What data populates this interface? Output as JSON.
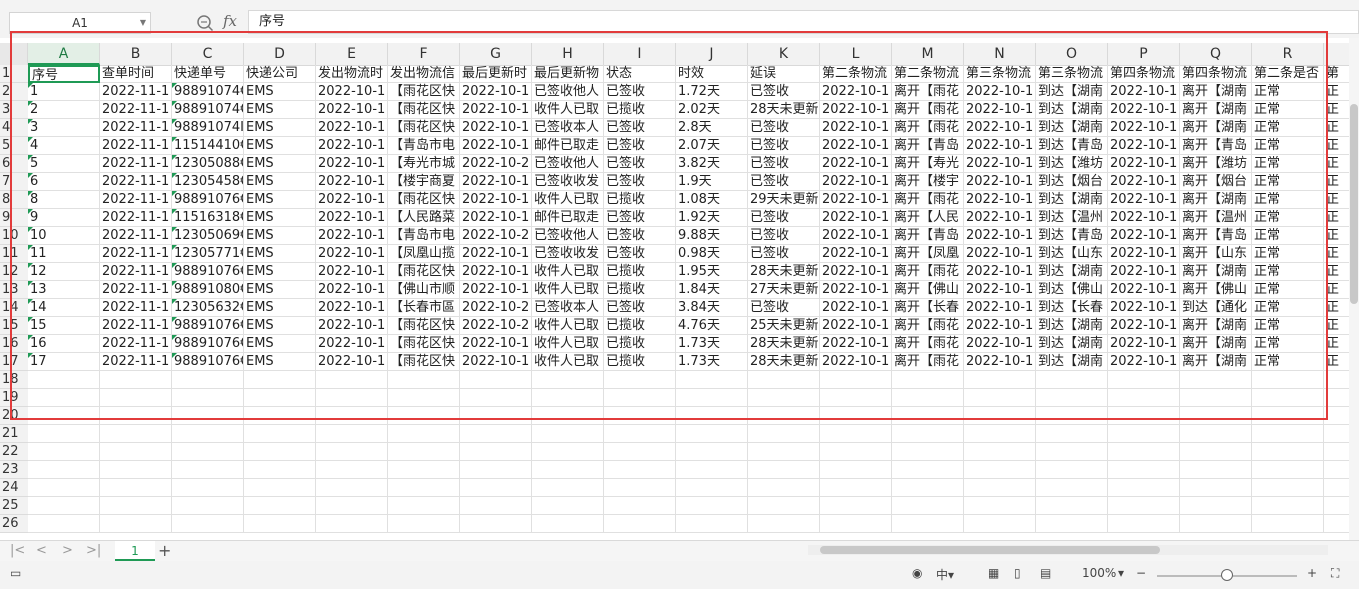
{
  "formula_bar": {
    "name_box": "A1",
    "fx_label": "fx",
    "formula_value": "序号"
  },
  "columns": [
    "A",
    "B",
    "C",
    "D",
    "E",
    "F",
    "G",
    "H",
    "I",
    "J",
    "K",
    "L",
    "M",
    "N",
    "O",
    "P",
    "Q",
    "R"
  ],
  "header_row": [
    "序号",
    "查单时间",
    "快递单号",
    "快递公司",
    "发出物流时",
    "发出物流信",
    "最后更新时",
    "最后更新物",
    "状态",
    "时效",
    "延误",
    "第二条物流",
    "第二条物流",
    "第三条物流",
    "第三条物流",
    "第四条物流",
    "第四条物流",
    "第二条是否",
    "第"
  ],
  "data_rows": [
    [
      "1",
      "2022-11-1",
      "98891074€",
      "EMS",
      "2022-10-1",
      "【雨花区快",
      "2022-10-1",
      "已签收他人",
      "已签收",
      "1.72天",
      "已签收",
      "2022-10-1",
      "离开【雨花",
      "2022-10-1",
      "到达【湖南",
      "2022-10-1",
      "离开【湖南",
      "正常",
      "正"
    ],
    [
      "2",
      "2022-11-1",
      "98891074€",
      "EMS",
      "2022-10-1",
      "【雨花区快",
      "2022-10-1",
      "收件人已取",
      "已揽收",
      "2.02天",
      "28天未更新",
      "2022-10-1",
      "离开【雨花",
      "2022-10-1",
      "到达【湖南",
      "2022-10-1",
      "离开【湖南",
      "正常",
      "正"
    ],
    [
      "3",
      "2022-11-1",
      "98891074I",
      "EMS",
      "2022-10-1",
      "【雨花区快",
      "2022-10-1",
      "已签收本人",
      "已签收",
      "2.8天",
      "已签收",
      "2022-10-1",
      "离开【雨花",
      "2022-10-1",
      "到达【湖南",
      "2022-10-1",
      "离开【湖南",
      "正常",
      "正"
    ],
    [
      "4",
      "2022-11-1",
      "11514410€",
      "EMS",
      "2022-10-1",
      "【青岛市电",
      "2022-10-1",
      "邮件已取走",
      "已签收",
      "2.07天",
      "已签收",
      "2022-10-1",
      "离开【青岛",
      "2022-10-1",
      "到达【青岛",
      "2022-10-1",
      "离开【青岛",
      "正常",
      "正"
    ],
    [
      "5",
      "2022-11-1",
      "12305088€",
      "EMS",
      "2022-10-1",
      "【寿光市城",
      "2022-10-2",
      "已签收他人",
      "已签收",
      "3.82天",
      "已签收",
      "2022-10-1",
      "离开【寿光",
      "2022-10-1",
      "到达【潍坊",
      "2022-10-1",
      "离开【潍坊",
      "正常",
      "正"
    ],
    [
      "6",
      "2022-11-1",
      "12305458€",
      "EMS",
      "2022-10-1",
      "【楼宇商夏",
      "2022-10-1",
      "已签收收发",
      "已签收",
      "1.9天",
      "已签收",
      "2022-10-1",
      "离开【楼宇",
      "2022-10-1",
      "到达【烟台",
      "2022-10-1",
      "离开【烟台",
      "正常",
      "正"
    ],
    [
      "8",
      "2022-11-1",
      "98891076€",
      "EMS",
      "2022-10-1",
      "【雨花区快",
      "2022-10-1",
      "收件人已取",
      "已揽收",
      "1.08天",
      "29天未更新",
      "2022-10-1",
      "离开【雨花",
      "2022-10-1",
      "到达【湖南",
      "2022-10-1",
      "离开【湖南",
      "正常",
      "正"
    ],
    [
      "9",
      "2022-11-1",
      "11516318€",
      "EMS",
      "2022-10-1",
      "【人民路菜",
      "2022-10-1",
      "邮件已取走",
      "已签收",
      "1.92天",
      "已签收",
      "2022-10-1",
      "离开【人民",
      "2022-10-1",
      "到达【温州",
      "2022-10-1",
      "离开【温州",
      "正常",
      "正"
    ],
    [
      "10",
      "2022-11-1",
      "12305069€",
      "EMS",
      "2022-10-1",
      "【青岛市电",
      "2022-10-2",
      "已签收他人",
      "已签收",
      "9.88天",
      "已签收",
      "2022-10-1",
      "离开【青岛",
      "2022-10-1",
      "到达【青岛",
      "2022-10-1",
      "离开【青岛",
      "正常",
      "正"
    ],
    [
      "11",
      "2022-11-1",
      "12305771€",
      "EMS",
      "2022-10-1",
      "【凤凰山揽",
      "2022-10-1",
      "已签收收发",
      "已签收",
      "0.98天",
      "已签收",
      "2022-10-1",
      "离开【凤凰",
      "2022-10-1",
      "到达【山东",
      "2022-10-1",
      "离开【山东",
      "正常",
      "正"
    ],
    [
      "12",
      "2022-11-1",
      "98891076€",
      "EMS",
      "2022-10-1",
      "【雨花区快",
      "2022-10-1",
      "收件人已取",
      "已揽收",
      "1.95天",
      "28天未更新",
      "2022-10-1",
      "离开【雨花",
      "2022-10-1",
      "到达【湖南",
      "2022-10-1",
      "离开【湖南",
      "正常",
      "正"
    ],
    [
      "13",
      "2022-11-1",
      "98891080€",
      "EMS",
      "2022-10-1",
      "【佛山市顺",
      "2022-10-1",
      "收件人已取",
      "已揽收",
      "1.84天",
      "27天未更新",
      "2022-10-1",
      "离开【佛山",
      "2022-10-1",
      "到达【佛山",
      "2022-10-1",
      "离开【佛山",
      "正常",
      "正"
    ],
    [
      "14",
      "2022-11-1",
      "12305632€",
      "EMS",
      "2022-10-1",
      "【长春市區",
      "2022-10-2",
      "已签收本人",
      "已签收",
      "3.84天",
      "已签收",
      "2022-10-1",
      "离开【长春",
      "2022-10-1",
      "到达【长春",
      "2022-10-1",
      "到达【通化",
      "正常",
      "正"
    ],
    [
      "15",
      "2022-11-1",
      "98891076€",
      "EMS",
      "2022-10-1",
      "【雨花区快",
      "2022-10-2",
      "收件人已取",
      "已揽收",
      "4.76天",
      "25天未更新",
      "2022-10-1",
      "离开【雨花",
      "2022-10-1",
      "到达【湖南",
      "2022-10-1",
      "离开【湖南",
      "正常",
      "正"
    ],
    [
      "16",
      "2022-11-1",
      "98891076€",
      "EMS",
      "2022-10-1",
      "【雨花区快",
      "2022-10-1",
      "收件人已取",
      "已揽收",
      "1.73天",
      "28天未更新",
      "2022-10-1",
      "离开【雨花",
      "2022-10-1",
      "到达【湖南",
      "2022-10-1",
      "离开【湖南",
      "正常",
      "正"
    ],
    [
      "17",
      "2022-11-1",
      "98891076€",
      "EMS",
      "2022-10-1",
      "【雨花区快",
      "2022-10-1",
      "收件人已取",
      "已揽收",
      "1.73天",
      "28天未更新",
      "2022-10-1",
      "离开【雨花",
      "2022-10-1",
      "到达【湖南",
      "2022-10-1",
      "离开【湖南",
      "正常",
      "正"
    ]
  ],
  "row_numbers": [
    "1",
    "2",
    "3",
    "4",
    "5",
    "6",
    "7",
    "8",
    "9",
    "10",
    "11",
    "12",
    "13",
    "14",
    "15",
    "16",
    "17",
    "18",
    "19",
    "20",
    "21",
    "22",
    "23",
    "24",
    "25",
    "26"
  ],
  "sheet_tab": "1",
  "status": {
    "zoom": "100%"
  },
  "colors": {
    "accent": "#1f9a55",
    "highlight_frame": "#e23b3b"
  }
}
